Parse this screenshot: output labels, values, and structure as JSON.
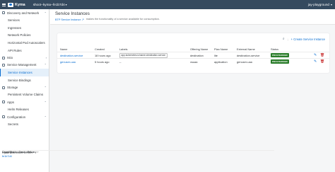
{
  "shell": {
    "brand": "Kyma",
    "cluster": "shoot--kyma--fe1b7d4",
    "user": "jay-playground"
  },
  "sidebar": {
    "groups": [
      {
        "label": "Discovery and Network",
        "items": [
          "Services",
          "Ingresses",
          "Network Policies",
          "Horizontal Pod Autoscalers",
          "API Rules"
        ]
      },
      {
        "label": "Istio",
        "items": []
      },
      {
        "label": "Service Management",
        "items": [
          "Service Instances",
          "Service Bindings"
        ]
      },
      {
        "label": "Storage",
        "items": [
          "Persistent Volume Claims"
        ]
      },
      {
        "label": "Apps",
        "items": [
          "Helm Releases"
        ]
      },
      {
        "label": "Configuration",
        "items": [
          "Secrets"
        ]
      }
    ],
    "footer": {
      "legal": "Legal Disclosure",
      "privacy": "Privacy",
      "copyright": "Copyright",
      "trademark": "Trademark",
      "version_label": "Kyma Dashboard version:",
      "version": "fe1b7d4"
    }
  },
  "header": {
    "title": "Service Instances",
    "link": "BTP Service Instance",
    "description": "makes the functionality of a service available for consumption."
  },
  "toolbar": {
    "create_label": "Create Service Instance"
  },
  "table": {
    "headers": [
      "Name",
      "Created",
      "Labels",
      "Offering Name",
      "Plan Name",
      "External Name",
      "Status"
    ],
    "rows": [
      {
        "name": "destination-service",
        "created": "18 hours ago",
        "label": "app.kubernetes.io/name=destination-service",
        "offering": "destination",
        "plan": "lite",
        "external": "destination-service",
        "status": "PROVISIONED"
      },
      {
        "name": "genuser-uaa",
        "created": "5 hours ago",
        "label": "--",
        "offering": "xsuaa",
        "plan": "application",
        "external": "genuser-uaa",
        "status": "PROVISIONED"
      }
    ]
  },
  "colors": {
    "shell": "#354a5f",
    "accent": "#0a6ed1",
    "status_ok": "#2b7d2b",
    "danger": "#bb0000"
  },
  "icons": [
    "menu-icon",
    "kyma-logo",
    "search-icon",
    "plus-icon",
    "edit-icon",
    "delete-icon",
    "chevron-icon",
    "external-link-icon"
  ]
}
